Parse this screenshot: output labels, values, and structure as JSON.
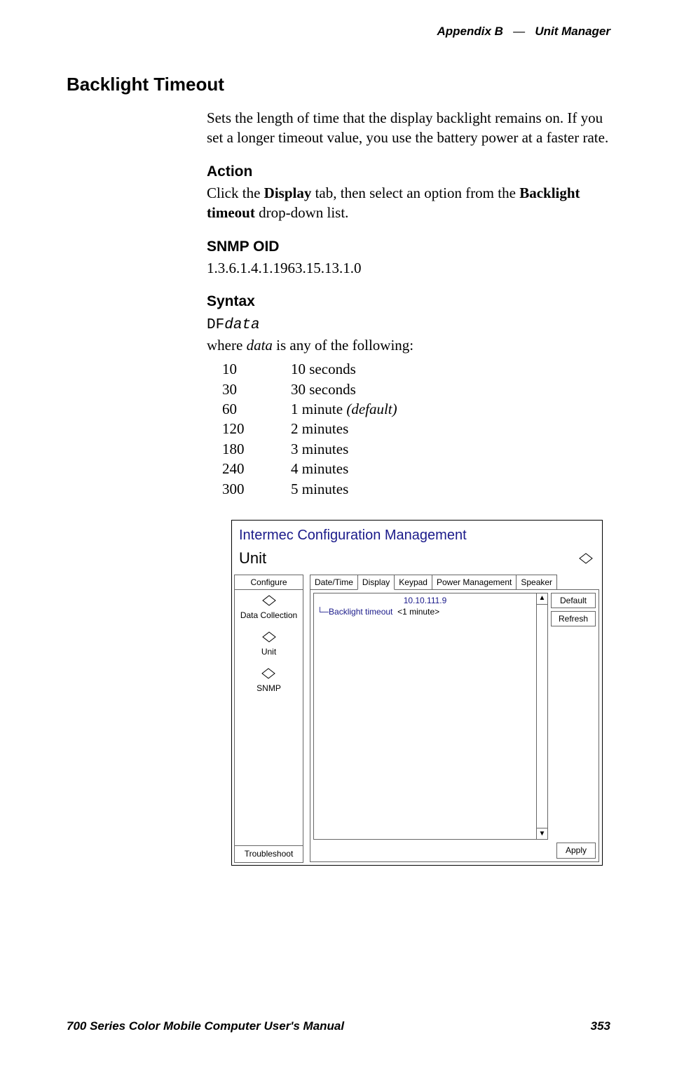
{
  "header": {
    "appendix": "Appendix B",
    "dash": "—",
    "section": "Unit Manager"
  },
  "title": "Backlight Timeout",
  "intro": "Sets the length of time that the display backlight remains on. If you set a longer timeout value, you use the battery power at a faster rate.",
  "action": {
    "heading": "Action",
    "pre": "Click the ",
    "bold1": "Display",
    "mid": " tab, then select an option from the ",
    "bold2": "Backlight timeout",
    "post": " drop-down list."
  },
  "snmp": {
    "heading": "SNMP OID",
    "value": "1.3.6.1.4.1.1963.15.13.1.0"
  },
  "syntax": {
    "heading": "Syntax",
    "code_prefix": "DF",
    "code_var": "data",
    "where_pre": "where ",
    "where_var": "data",
    "where_post": " is any of the following:"
  },
  "options": [
    {
      "code": "10",
      "desc": "10 seconds",
      "suffix": ""
    },
    {
      "code": "30",
      "desc": "30 seconds",
      "suffix": ""
    },
    {
      "code": "60",
      "desc": "1 minute ",
      "suffix": "(default)"
    },
    {
      "code": "120",
      "desc": "2 minutes",
      "suffix": ""
    },
    {
      "code": "180",
      "desc": "3 minutes",
      "suffix": ""
    },
    {
      "code": "240",
      "desc": "4 minutes",
      "suffix": ""
    },
    {
      "code": "300",
      "desc": "5 minutes",
      "suffix": ""
    }
  ],
  "screenshot": {
    "title": "Intermec Configuration Management",
    "unit_label": "Unit",
    "sidebar": {
      "configure": "Configure",
      "items": [
        {
          "label": "Data Collection"
        },
        {
          "label": "Unit"
        },
        {
          "label": "SNMP"
        }
      ],
      "troubleshoot": "Troubleshoot"
    },
    "tabs": [
      "Date/Time",
      "Display",
      "Keypad",
      "Power Management",
      "Speaker"
    ],
    "active_tab_index": 1,
    "ip": "10.10.111.9",
    "row_label": "Backlight timeout",
    "row_value": "<1 minute>",
    "buttons": {
      "default": "Default",
      "refresh": "Refresh",
      "apply": "Apply"
    }
  },
  "footer": {
    "manual": "700 Series Color Mobile Computer User's Manual",
    "page": "353"
  }
}
